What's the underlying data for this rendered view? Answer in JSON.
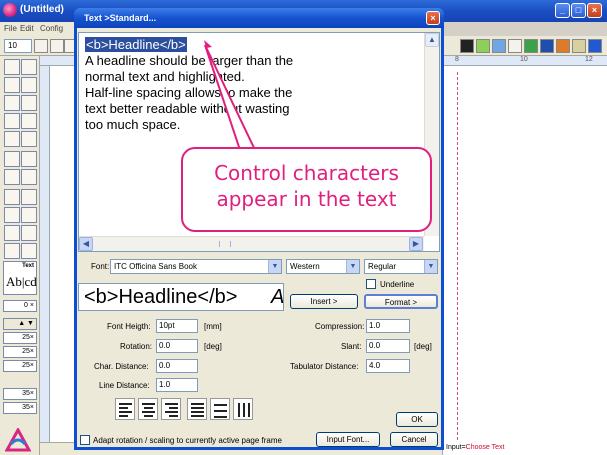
{
  "app": {
    "title": "(Untitled)",
    "menu": [
      "File",
      "Edit",
      "Config"
    ],
    "zoom": "10",
    "status_input_label": "Input=",
    "status_input_value": "Choose Text"
  },
  "palette": {
    "text_tool_label": "Text",
    "text_sample": "Ab|cd",
    "line_swatches": [
      "0",
      "25",
      "25",
      "25",
      "35",
      "35"
    ]
  },
  "ruler": {
    "marks": [
      "8",
      "10",
      "12"
    ]
  },
  "dialog": {
    "title": "Text >Standard...",
    "text_lines": [
      "<b>Headline</b>",
      "A headline should be larger than the",
      "normal text and highlighted.",
      "Half-line spacing allows to make the",
      "text better readable without wasting",
      "too much space."
    ],
    "font_label": "Font:",
    "font_value": "ITC Officina Sans Book",
    "script_value": "Western",
    "style_value": "Regular",
    "underline_label": "Underline",
    "insert_label": "Insert >",
    "format_label": "Format >",
    "preview_text": "<b>Headline</b>",
    "preview_tail": "A",
    "font_height_label": "Font Heigth:",
    "font_height_value": "10pt",
    "font_height_unit": "[mm]",
    "rotation_label": "Rotation:",
    "rotation_value": "0.0",
    "rotation_unit": "[deg]",
    "char_distance_label": "Char. Distance:",
    "char_distance_value": "0.0",
    "line_distance_label": "Line Distance:",
    "line_distance_value": "1.0",
    "compression_label": "Compression:",
    "compression_value": "1.0",
    "slant_label": "Slant:",
    "slant_value": "0.0",
    "slant_unit": "[deg]",
    "tab_distance_label": "Tabulator Distance:",
    "tab_distance_value": "4.0",
    "ok_label": "OK",
    "adapt_label": "Adapt rotation / scaling to currently active page frame",
    "input_font_label": "Input Font...",
    "cancel_label": "Cancel"
  },
  "annotation": {
    "line1": "Control characters",
    "line2": "appear in the text",
    "color": "#e0207f"
  }
}
